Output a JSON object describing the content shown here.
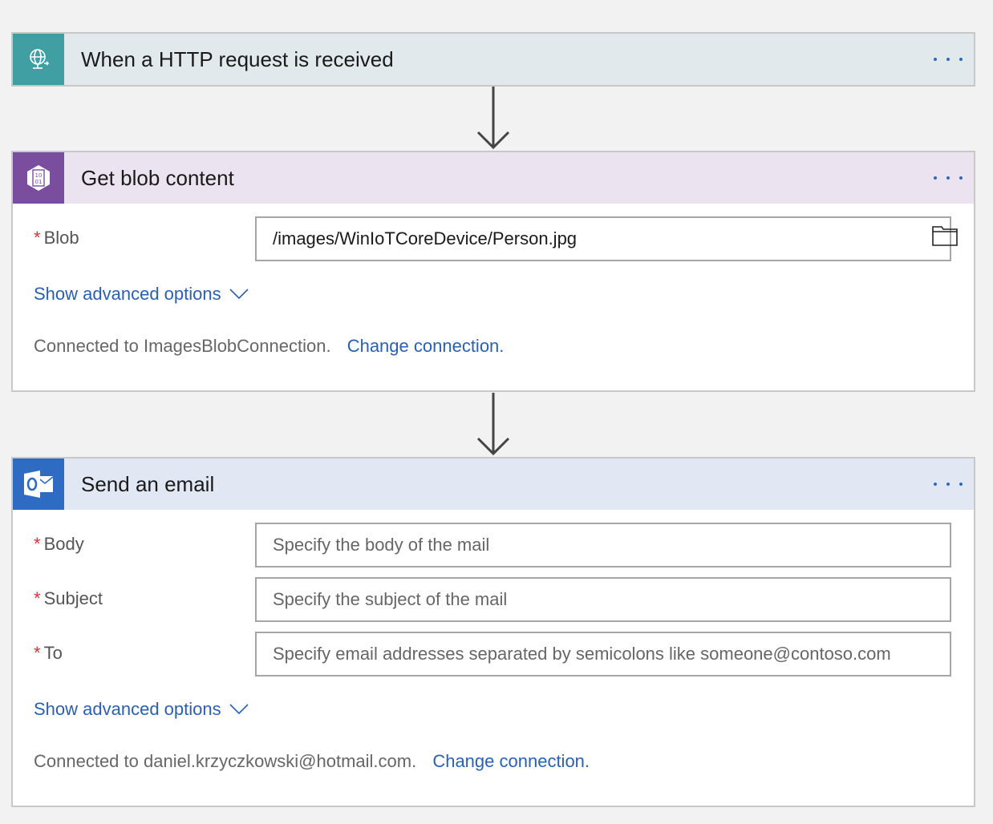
{
  "trigger": {
    "title": "When a HTTP request is received",
    "icon": "globe-request-icon",
    "header_bg": "#e1e9ec",
    "icon_bg": "#3f9fa3"
  },
  "blob_step": {
    "title": "Get blob content",
    "icon": "blob-storage-icon",
    "header_bg": "#ebe3ef",
    "icon_bg": "#7a4d9e",
    "required_mark": "*",
    "blob_label": "Blob",
    "blob_value": "/images/WinIoTCoreDevice/Person.jpg",
    "advanced_label": "Show advanced options",
    "connected_text": "Connected to ImagesBlobConnection.",
    "change_connection": "Change connection."
  },
  "email_step": {
    "title": "Send an email",
    "icon": "outlook-icon",
    "header_bg": "#e2e8f3",
    "icon_bg": "#2e6cc4",
    "required_mark": "*",
    "body_label": "Body",
    "body_placeholder": "Specify the body of the mail",
    "subject_label": "Subject",
    "subject_placeholder": "Specify the subject of the mail",
    "to_label": "To",
    "to_placeholder": "Specify email addresses separated by semicolons like someone@contoso.com",
    "advanced_label": "Show advanced options",
    "connected_text": "Connected to daniel.krzyczkowski@hotmail.com.",
    "change_connection": "Change connection."
  },
  "colors": {
    "link": "#2b5fb0",
    "required": "#d13438",
    "more_dots": "#2b6bbf"
  }
}
